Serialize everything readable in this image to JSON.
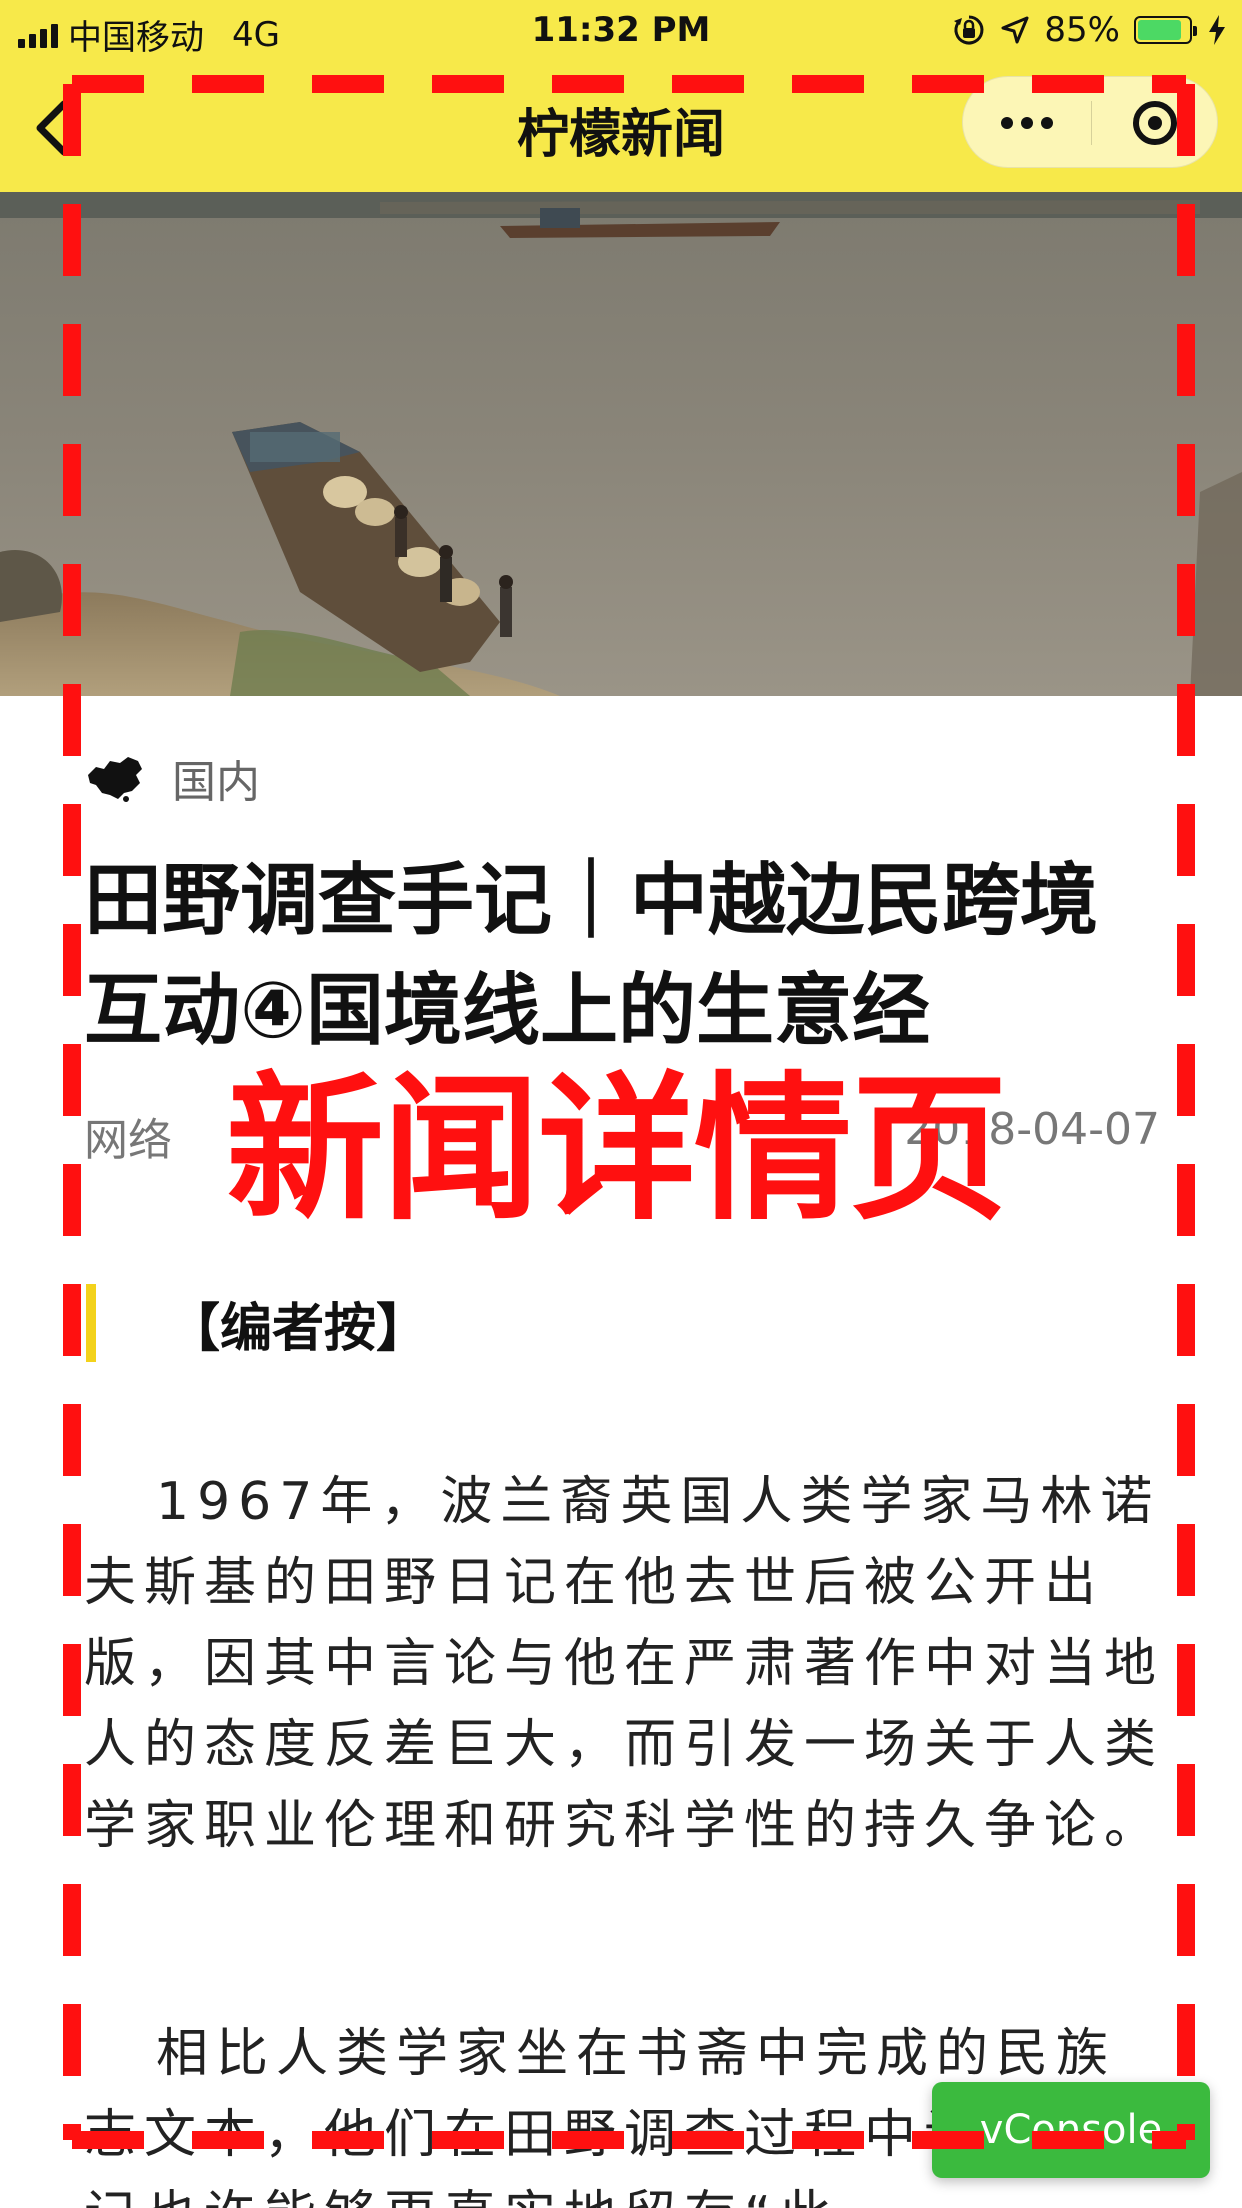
{
  "status_bar": {
    "carrier": "中国移动",
    "network": "4G",
    "time": "11:32 PM",
    "battery": "85%",
    "battery_level": 0.85,
    "icons": [
      "signal-icon",
      "orientation-lock-icon",
      "location-icon",
      "battery-icon",
      "charging-icon"
    ]
  },
  "nav": {
    "title": "柠檬新闻",
    "back_icon": "chevron-left-icon",
    "more_icon": "more-dots-icon",
    "close_icon": "target-circle-icon"
  },
  "article": {
    "category_icon": "china-map-icon",
    "category": "国内",
    "title": "田野调查手记｜中越边民跨境互动④国境线上的生意经",
    "source": "网络",
    "date": "2018-04-07",
    "section_heading": "【编者按】",
    "paragraphs": [
      "1967年，波兰裔英国人类学家马林诺夫斯基的田野日记在他去世后被公开出版，因其中言论与他在严肃著作中对当地人的态度反差巨大，而引发一场关于人类学家职业伦理和研究科学性的持久争论。",
      "相比人类学家坐在书斋中完成的民族志文本，他们在田野调查过程中记下的笔记也许能够更真实地留存“此"
    ]
  },
  "annotation": {
    "label": "新闻详情页",
    "color": "#ff1010"
  },
  "vconsole": {
    "label": "vConsole",
    "color": "#3bba3e"
  },
  "colors": {
    "header_bg": "#f7e94a",
    "section_accent": "#f3d21b"
  }
}
